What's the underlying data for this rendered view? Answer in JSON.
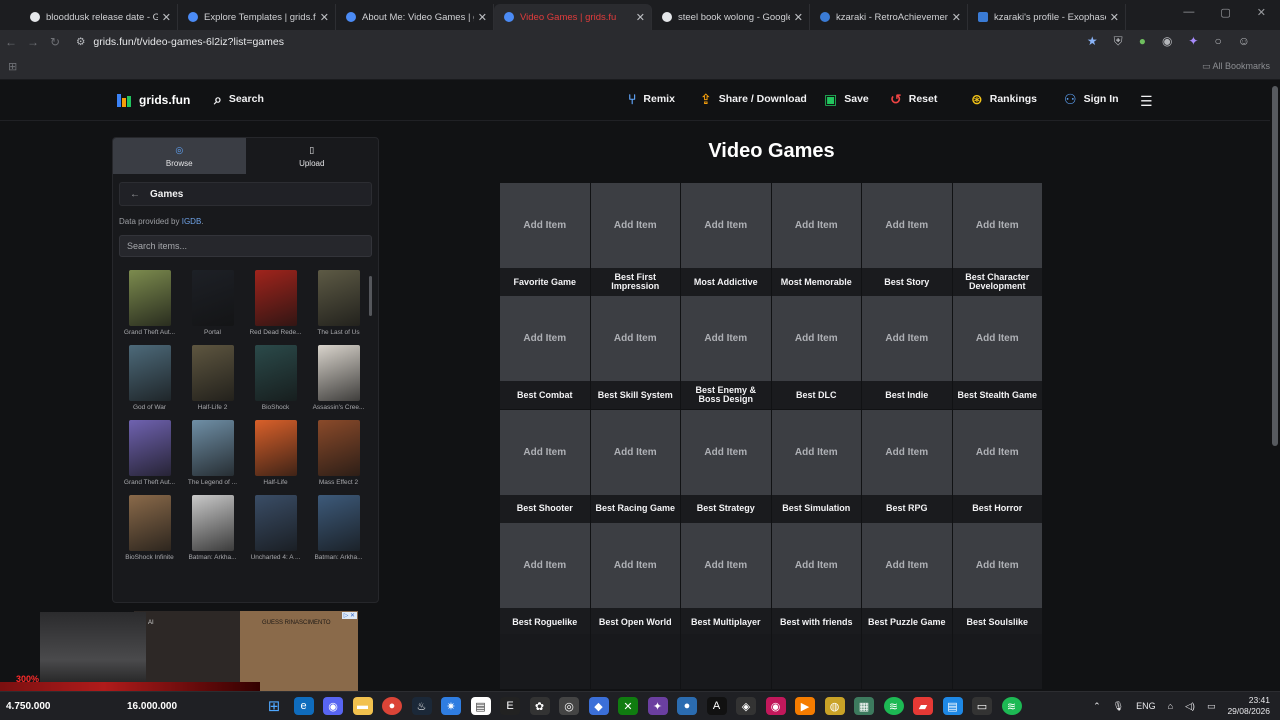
{
  "browser": {
    "tabs": [
      {
        "title": "blooddusk release date - Goog",
        "favicon": "google-icon"
      },
      {
        "title": "Explore Templates | grids.fun",
        "favicon": "grids-icon"
      },
      {
        "title": "About Me: Video Games | grids",
        "favicon": "grids-icon"
      },
      {
        "title": "Video Games | grids.fu",
        "favicon": "grids-icon",
        "active": true
      },
      {
        "title": "steel book wolong - Google Se",
        "favicon": "google-icon"
      },
      {
        "title": "kzaraki - RetroAchievements",
        "favicon": "retroachievements-icon"
      },
      {
        "title": "kzaraki's profile - Exophase.com",
        "favicon": "exophase-icon"
      }
    ],
    "url": "grids.fun/t/video-games-6l2iz?list=games",
    "all_bookmarks": "All Bookmarks"
  },
  "header": {
    "logo": "grids.fun",
    "search": "Search",
    "remix": "Remix",
    "share": "Share / Download",
    "save": "Save",
    "reset": "Reset",
    "rankings": "Rankings",
    "signin": "Sign In"
  },
  "sidebar": {
    "browse": "Browse",
    "upload": "Upload",
    "category": "Games",
    "provider_prefix": "Data provided by",
    "provider": "IGDB",
    "provider_suffix": ".",
    "search_placeholder": "Search items...",
    "games": [
      {
        "name": "Grand Theft Aut...",
        "color": "#7c8b4e"
      },
      {
        "name": "Portal",
        "color": "#1d2026"
      },
      {
        "name": "Red Dead Rede...",
        "color": "#a0241c"
      },
      {
        "name": "The Last of Us",
        "color": "#5d5a45"
      },
      {
        "name": "God of War",
        "color": "#4d6a7a"
      },
      {
        "name": "Half-Life 2",
        "color": "#5e5640"
      },
      {
        "name": "BioShock",
        "color": "#2b4a4a"
      },
      {
        "name": "Assassin's Cree...",
        "color": "#d9d4cc"
      },
      {
        "name": "Grand Theft Aut...",
        "color": "#6f62b0"
      },
      {
        "name": "The Legend of ...",
        "color": "#6f8fa6"
      },
      {
        "name": "Half-Life",
        "color": "#d9602a"
      },
      {
        "name": "Mass Effect 2",
        "color": "#8a4a2a"
      },
      {
        "name": "BioShock Infinite",
        "color": "#8a6a4a"
      },
      {
        "name": "Batman: Arkha...",
        "color": "#c9c9c9"
      },
      {
        "name": "Uncharted 4: A ...",
        "color": "#3a4d66"
      },
      {
        "name": "Batman: Arkha...",
        "color": "#3d5a7a"
      }
    ],
    "ad_text": "GUESS RINASCIMENTO",
    "ad_label": "AI"
  },
  "board": {
    "title": "Video Games",
    "add_label": "Add Item",
    "cells": [
      "Favorite Game",
      "Best First Impression",
      "Most Addictive",
      "Most Memorable",
      "Best Story",
      "Best Character Development",
      "Best Combat",
      "Best Skill System",
      "Best Enemy & Boss Design",
      "Best DLC",
      "Best Indie",
      "Best Stealth Game",
      "Best Shooter",
      "Best Racing Game",
      "Best Strategy",
      "Best Simulation",
      "Best RPG",
      "Best Horror",
      "Best Roguelike",
      "Best Open World",
      "Best Multiplayer",
      "Best with friends",
      "Best Puzzle Game",
      "Best Soulslike"
    ]
  },
  "overlay": {
    "percent": "300%",
    "score_left": "4.750.000",
    "score_right": "16.000.000"
  },
  "taskbar": {
    "lang": "ENG",
    "time": "23:41",
    "date": "29/08/2026"
  }
}
